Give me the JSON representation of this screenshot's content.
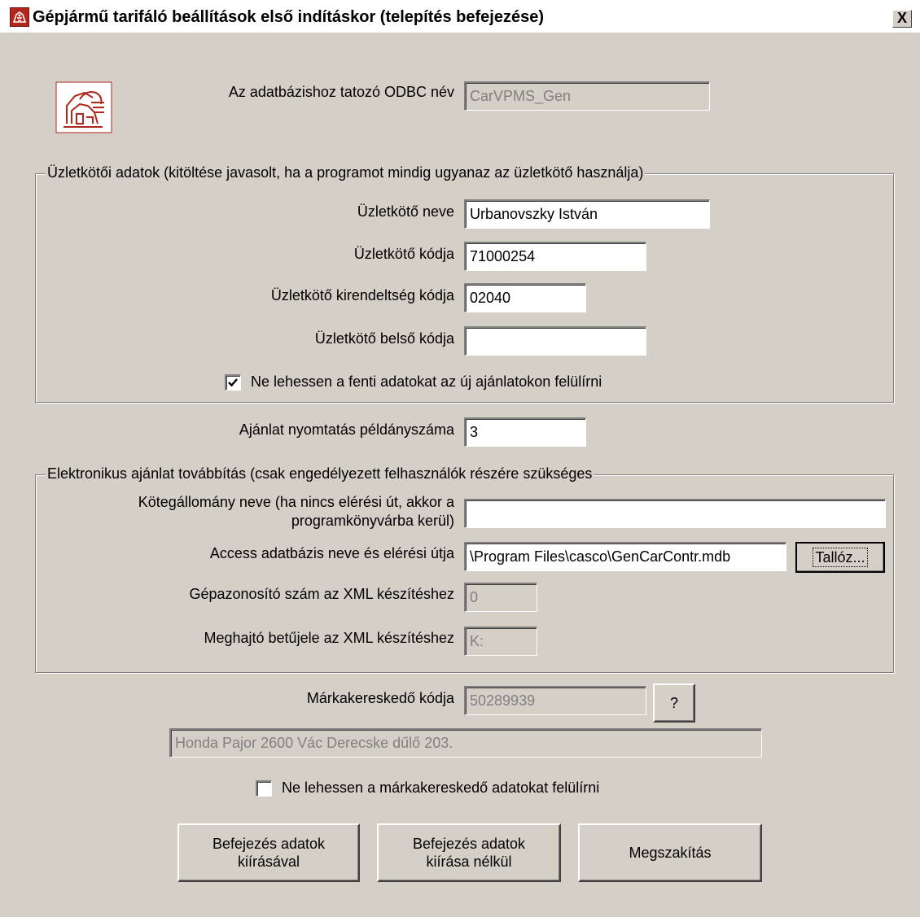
{
  "window": {
    "title": "Gépjármű tarifáló beállítások első indításkor (telepítés befejezése)",
    "close_label": "X"
  },
  "odbc": {
    "label": "Az adatbázishoz tatozó ODBC név",
    "value": "CarVPMS_Gen"
  },
  "agent_group": {
    "title": "Üzletkötői adatok (kitöltése javasolt, ha a programot mindig ugyanaz az üzletkötő használja)",
    "name_label": "Üzletkötő neve",
    "name_value": "Urbanovszky István",
    "code_label": "Üzletkötő kódja",
    "code_value": "71000254",
    "branch_label": "Üzletkötő kirendeltség kódja",
    "branch_value": "02040",
    "internal_label": "Üzletkötő belső kódja",
    "internal_value": "",
    "lock_checkbox_label": "Ne lehessen a fenti adatokat az új ajánlatokon felülírni",
    "lock_checked": true
  },
  "print_copies": {
    "label": "Ajánlat nyomtatás példányszáma",
    "value": "3"
  },
  "electronic_group": {
    "title": "Elektronikus ajánlat továbbítás (csak engedélyezett felhasználók részére szükséges",
    "batch_label_line1": "Kötegállomány neve (ha nincs elérési út, akkor a",
    "batch_label_line2": "programkönyvárba kerül)",
    "batch_value": "",
    "access_label": "Access adatbázis neve és elérési útja",
    "access_value": "\\Program Files\\casco\\GenCarContr.mdb",
    "browse_label": "Tallóz...",
    "machine_label": "Gépazonosító szám az XML készítéshez",
    "machine_value": "0",
    "drive_label": "Meghajtó betűjele az XML készítéshez",
    "drive_value": "K:"
  },
  "dealer": {
    "label": "Márkakereskedő kódja",
    "code_value": "50289939",
    "help_label": "?",
    "address_value": "Honda Pajor 2600 Vác Derecske dűlő 203.",
    "lock_checkbox_label": "Ne lehessen a márkakereskedő adatokat felülírni",
    "lock_checked": false
  },
  "buttons": {
    "finish_save_line1": "Befejezés adatok",
    "finish_save_line2": "kiírásával",
    "finish_nosave_line1": "Befejezés adatok",
    "finish_nosave_line2": "kiírása nélkül",
    "cancel": "Megszakítás"
  },
  "colors": {
    "face": "#d4d0c8",
    "shadow": "#808080",
    "highlight": "#ffffff",
    "disabled_text": "#808080",
    "logo_red": "#b3261e"
  }
}
